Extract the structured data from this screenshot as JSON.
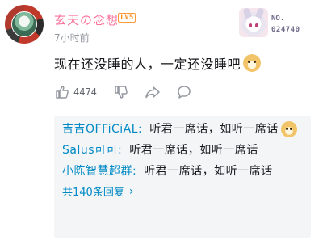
{
  "comment": {
    "username": "玄天の念想",
    "level_badge": "LV5",
    "time": "7小时前",
    "fan_card": {
      "no_label": "NO.",
      "number": "024740"
    },
    "text": "现在还没睡的人，一定还没睡吧",
    "emoji": "doge",
    "like_count": "4474"
  },
  "replies": [
    {
      "name": "吉吉OFFiCiAL",
      "separator": ":",
      "text": "听君一席话，如听一席话",
      "emoji": "doge"
    },
    {
      "name": "Salus可可",
      "separator": ":",
      "text": "听君一席话，如听一席话"
    },
    {
      "name": "小陈智慧超群",
      "separator": ":",
      "text": "听君一席话，如听一席话"
    }
  ],
  "more_replies": "共140条回复",
  "colors": {
    "username": "#fb7299",
    "reply_name": "#008ac5",
    "level": "#ff8a1f",
    "muted": "#9499a0",
    "reply_bg": "#f4f5f7"
  },
  "icons": [
    "thumbs-up-icon",
    "thumbs-down-icon",
    "share-icon",
    "comment-icon",
    "chevron-right-icon"
  ]
}
